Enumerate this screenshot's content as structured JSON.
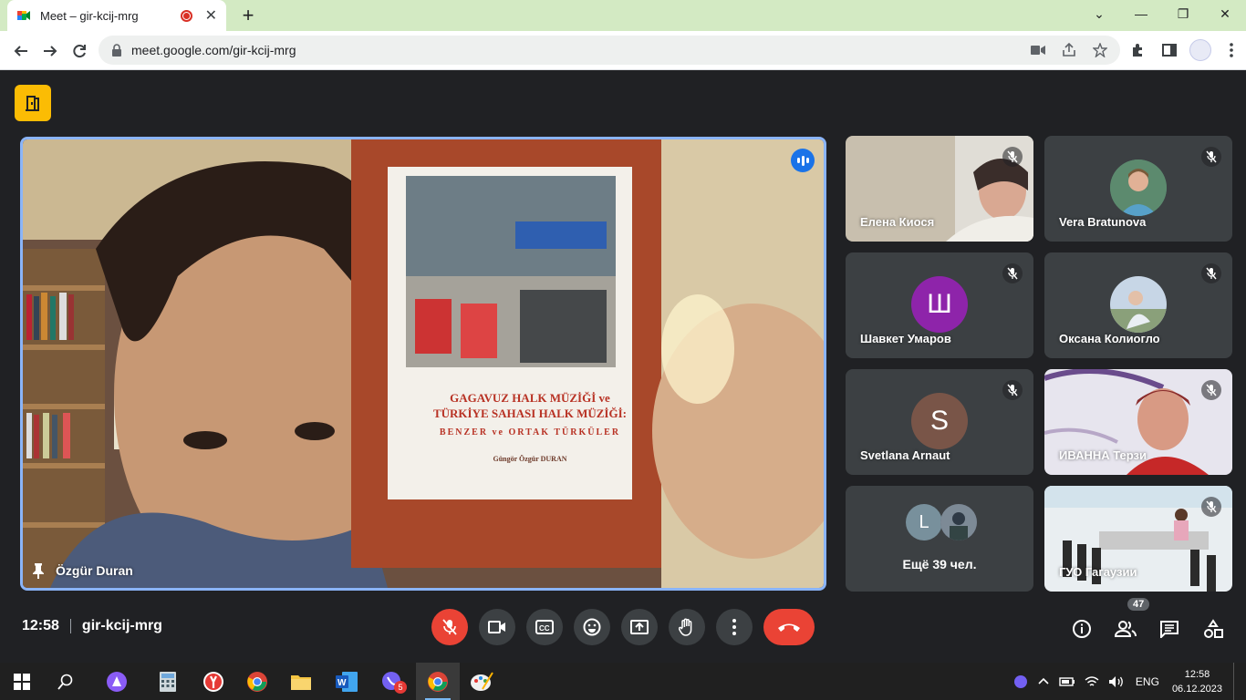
{
  "browser": {
    "tab_title": "Meet – gir-kcij-mrg",
    "url": "meet.google.com/gir-kcij-mrg",
    "new_tab_symbol": "+",
    "tab_close_symbol": "✕",
    "window_controls": [
      "⌄",
      "—",
      "❐",
      "✕"
    ]
  },
  "meet": {
    "main_speaker": {
      "name": "Özgür Duran",
      "pinned": true,
      "speaking": true
    },
    "book": {
      "title_line1": "GAGAVUZ HALK MÜZİĞİ ve",
      "title_line2": "TÜRKİYE SAHASI HALK MÜZİĞİ:",
      "subtitle": "BENZER ve ORTAK TÜRKÜLER",
      "author": "Güngör Özgür DURAN"
    },
    "participants": [
      {
        "name": "Елена Киося",
        "muted": true,
        "type": "video"
      },
      {
        "name": "Vera Bratunova",
        "muted": true,
        "type": "photo"
      },
      {
        "name": "Шавкет Умаров",
        "muted": true,
        "type": "letter",
        "letter": "Ш",
        "color": "#8e24aa"
      },
      {
        "name": "Оксана Колиогло",
        "muted": true,
        "type": "photo"
      },
      {
        "name": "Svetlana Arnaut",
        "muted": true,
        "type": "letter",
        "letter": "S",
        "color": "#795548"
      },
      {
        "name": "ИВАННА Терзи",
        "muted": true,
        "type": "video"
      },
      {
        "name": "ГУО Гагаузии",
        "muted": true,
        "type": "video"
      }
    ],
    "more": {
      "label": "Ещё 39 чел.",
      "letter": "L"
    },
    "bottom": {
      "time": "12:58",
      "meeting_code": "gir-kcij-mrg",
      "participant_count": "47"
    }
  },
  "taskbar": {
    "viber_badge": "5",
    "lang": "ENG",
    "time": "12:58",
    "date": "06.12.2023"
  }
}
